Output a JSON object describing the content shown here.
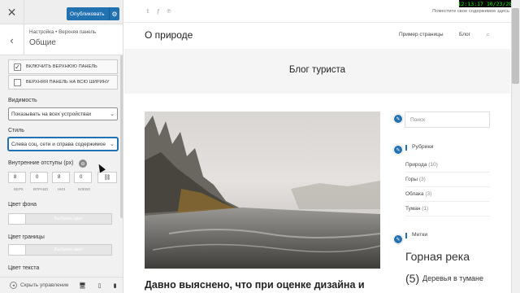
{
  "customizer": {
    "publish_label": "Опубликовать",
    "breadcrumb": "Настройка • Верхняя панель",
    "section_title": "Общие",
    "enable_topbar": {
      "label": "ВКЛЮЧИТЬ ВЕРХНЮЮ ПАНЕЛЬ",
      "checked": true,
      "mark": "✓"
    },
    "fullwidth_topbar": {
      "label": "ВЕРХНЯЯ ПАНЕЛЬ НА ВСЮ ШИРИНУ",
      "checked": false
    },
    "visibility": {
      "label": "Видимость",
      "value": "Показывать на всех устройствах"
    },
    "style": {
      "label": "Стиль",
      "value": "Слева соц. сети и справа содержимое"
    },
    "padding": {
      "label": "Внутренние отступы (px)",
      "values": [
        "8",
        "0",
        "8",
        "0"
      ],
      "captions": [
        "ВЕРХ",
        "ВПРАВО",
        "НИЗ",
        "ВЛЕВО"
      ]
    },
    "bg_color": {
      "label": "Цвет фона",
      "button": "Выбрать цвет"
    },
    "border_color": {
      "label": "Цвет границы",
      "button": "Выбрать цвет"
    },
    "text_color": {
      "label": "Цвет текста"
    },
    "collapse_label": "Скрыть управление"
  },
  "clock": {
    "time": "12:13:17",
    "date": "10/23/2020"
  },
  "preview": {
    "topbar_text": "Поместите свое содержимое здесь",
    "site_title": "О природе",
    "menu": [
      "Пример страницы",
      "Блог"
    ],
    "banner_title": "Блог туриста",
    "search_placeholder": "Поиск",
    "categories_title": "Рубрики",
    "categories": [
      {
        "name": "Природа",
        "count": "(10)"
      },
      {
        "name": "Горы",
        "count": "(3)"
      },
      {
        "name": "Облака",
        "count": "(3)"
      },
      {
        "name": "Туман",
        "count": "(1)"
      }
    ],
    "tags_title": "Метки",
    "tag_big": "Горная река",
    "tag_count": "(5)",
    "tag_small": "Деревья в тумане",
    "post_title": "Давно выяснено, что при оценке дизайна и"
  },
  "icons": {
    "close": "close-icon",
    "back": "chevron-left-icon",
    "gear": "gear-icon",
    "twitter": "twitter-icon",
    "facebook": "facebook-icon",
    "pinterest": "pinterest-icon",
    "search": "search-icon",
    "edit": "pencil-icon"
  },
  "colors": {
    "accent": "#2271b1",
    "clock_fg": "#00ff00"
  }
}
